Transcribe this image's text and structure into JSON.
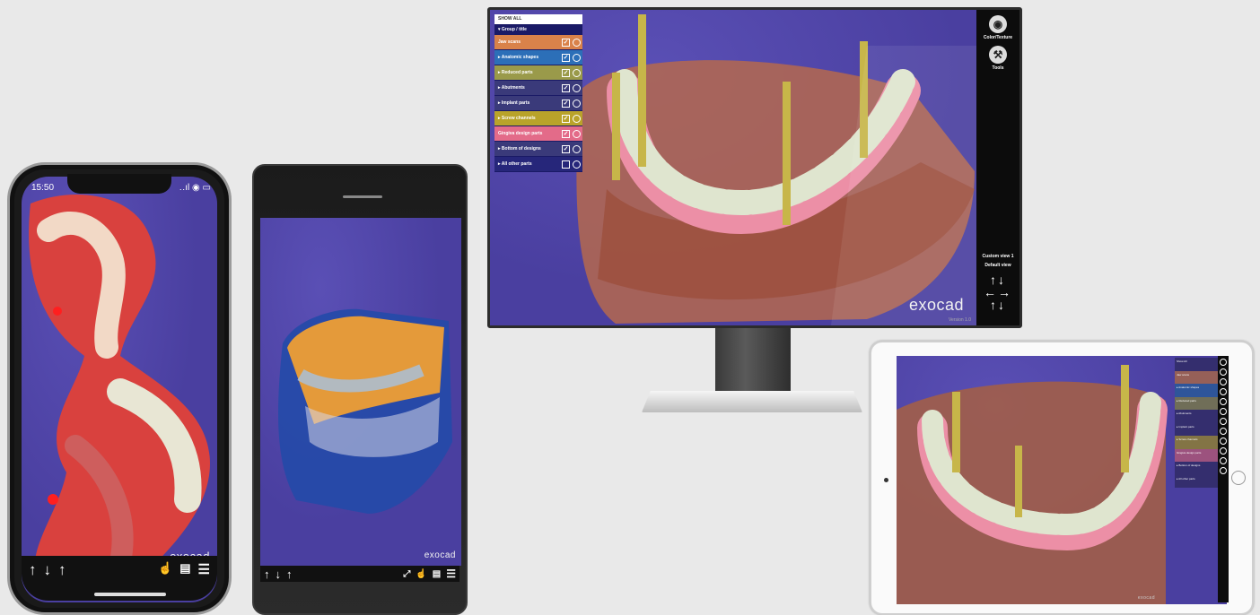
{
  "phone": {
    "time": "15:50",
    "status_icons": "‥ıl ◉ ▭",
    "brand": "exocad",
    "nav_arrows": [
      "↑",
      "↓",
      "↑"
    ],
    "nav_icons": [
      "touch-icon",
      "legend-icon",
      "menu-icon"
    ]
  },
  "android": {
    "brand": "exocad",
    "nav_arrows": [
      "↑",
      "↓",
      "↑"
    ],
    "nav_icons": [
      "expand-icon",
      "touch-icon",
      "legend-icon",
      "menu-icon"
    ]
  },
  "monitor": {
    "show_all": "SHOW ALL",
    "group_label": "▾ Group / title",
    "parts": [
      {
        "label": "Jaw scans",
        "color": "#d9824a",
        "checked": true
      },
      {
        "label": "▸ Anatomic shapes",
        "color": "#2c6fb8",
        "checked": true
      },
      {
        "label": "▸ Reduced parts",
        "color": "#9a9a4a",
        "checked": true
      },
      {
        "label": "▸ Abutments",
        "color": "#3a3a7a",
        "checked": true
      },
      {
        "label": "▸ Implant parts",
        "color": "#3a3a7a",
        "checked": true
      },
      {
        "label": "▸ Screw channels",
        "color": "#b9a32a",
        "checked": true
      },
      {
        "label": "Gingiva design parts",
        "color": "#e36b89",
        "checked": true
      },
      {
        "label": "▸ Bottom of designs",
        "color": "#3a3a7a",
        "checked": true
      },
      {
        "label": "▸ All other parts",
        "color": "#26267a",
        "checked": false
      }
    ],
    "tools": [
      {
        "label": "Color/Texture",
        "icon": "palette-icon",
        "glyph": "◉"
      },
      {
        "label": "Tools",
        "icon": "tools-icon",
        "glyph": "⚒"
      }
    ],
    "view_labels": [
      "Custom view 1",
      "Default view"
    ],
    "arrows": [
      "↑↓",
      "←→",
      "↑↓"
    ],
    "brand": "exocad",
    "version": "Version 1.0"
  },
  "tablet": {
    "panel_rows": [
      "Show All",
      "Jaw scans",
      "▸ Anatomic shapes",
      "▸ Reduced parts",
      "▸ Abutments",
      "▸ Implant parts",
      "▸ Screw channels",
      "Gingiva design parts",
      "▸ Bottom of designs",
      "▸ All other parts"
    ],
    "brand": "exocad"
  }
}
